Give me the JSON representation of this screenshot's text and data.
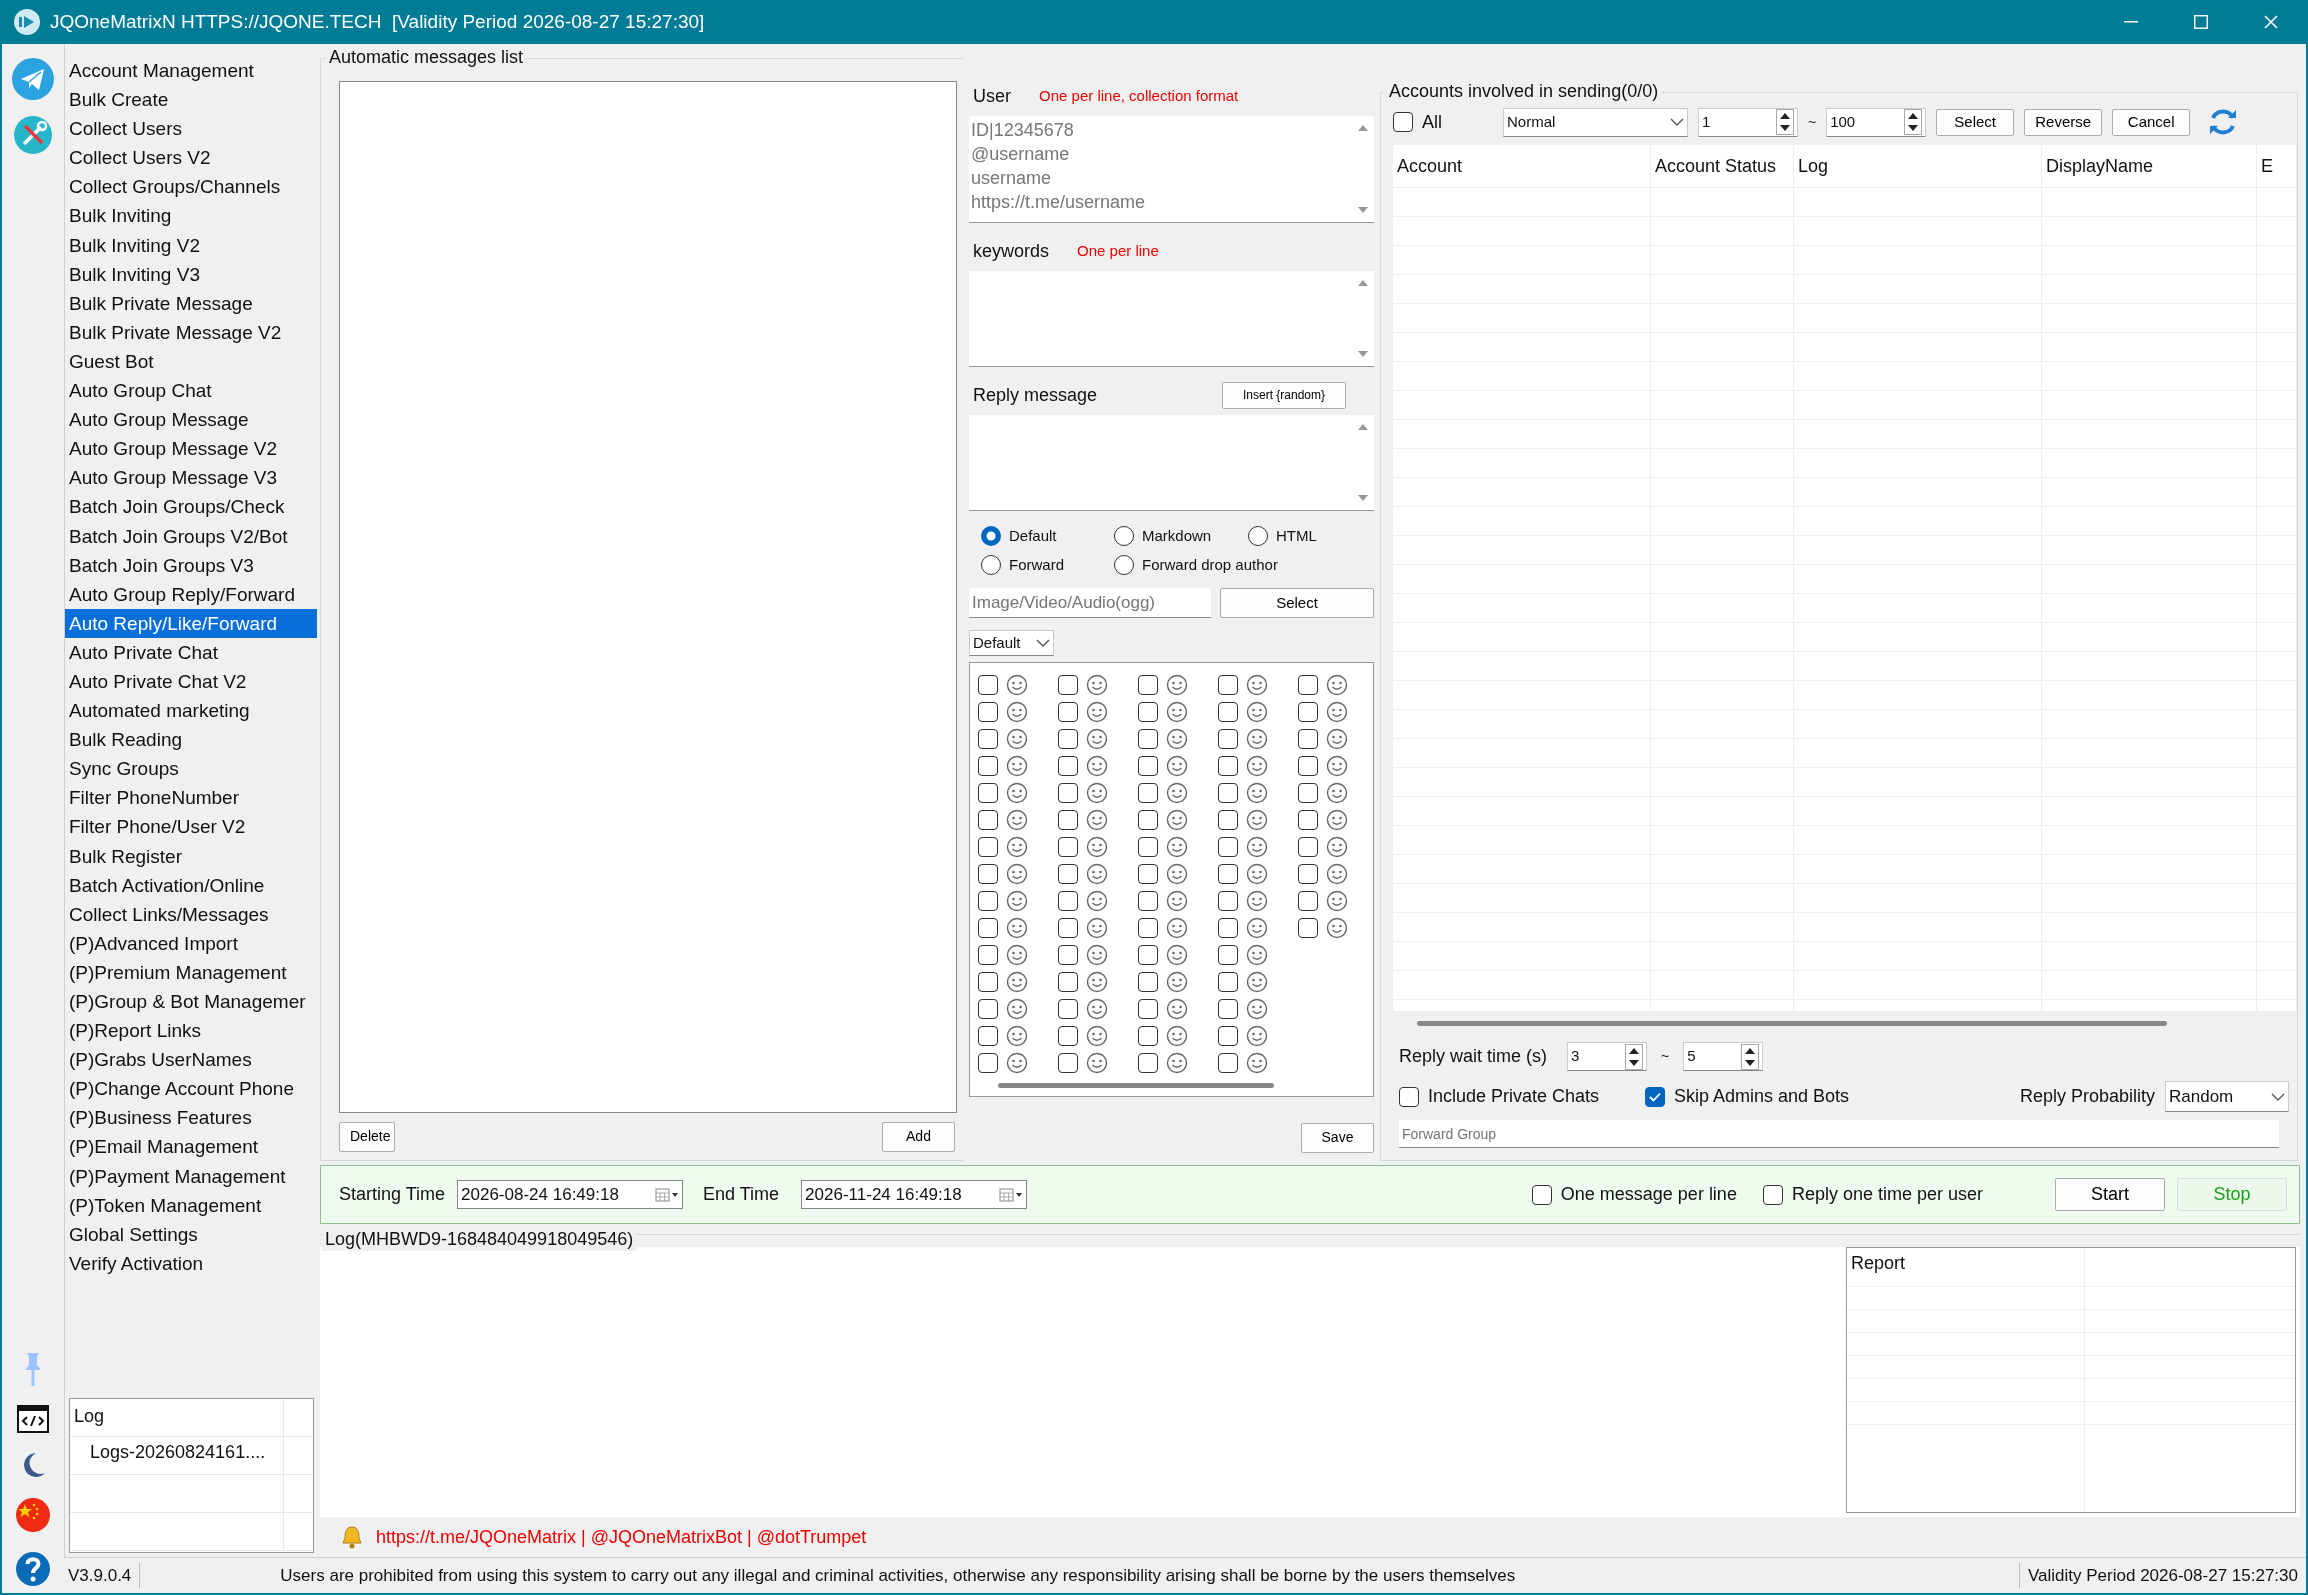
{
  "window": {
    "title": "JQOneMatrixN HTTPS://JQONE.TECH  [Validity Period 2026-08-27 15:27:30]"
  },
  "sidebar": {
    "items": [
      {
        "label": "Account Management",
        "selected": false
      },
      {
        "label": "Bulk Create",
        "selected": false
      },
      {
        "label": "Collect Users",
        "selected": false
      },
      {
        "label": "Collect Users V2",
        "selected": false
      },
      {
        "label": "Collect Groups/Channels",
        "selected": false
      },
      {
        "label": "Bulk Inviting",
        "selected": false
      },
      {
        "label": "Bulk Inviting V2",
        "selected": false
      },
      {
        "label": "Bulk Inviting V3",
        "selected": false
      },
      {
        "label": "Bulk Private Message",
        "selected": false
      },
      {
        "label": "Bulk Private Message V2",
        "selected": false
      },
      {
        "label": "Guest Bot",
        "selected": false
      },
      {
        "label": "Auto Group Chat",
        "selected": false
      },
      {
        "label": "Auto Group Message",
        "selected": false
      },
      {
        "label": "Auto Group Message V2",
        "selected": false
      },
      {
        "label": "Auto Group Message V3",
        "selected": false
      },
      {
        "label": "Batch Join Groups/Check",
        "selected": false
      },
      {
        "label": "Batch Join Groups V2/Bot",
        "selected": false
      },
      {
        "label": "Batch Join Groups V3",
        "selected": false
      },
      {
        "label": "Auto Group Reply/Forward",
        "selected": false
      },
      {
        "label": "Auto Reply/Like/Forward",
        "selected": true
      },
      {
        "label": "Auto Private Chat",
        "selected": false
      },
      {
        "label": "Auto Private Chat V2",
        "selected": false
      },
      {
        "label": "Automated marketing",
        "selected": false
      },
      {
        "label": "Bulk Reading",
        "selected": false
      },
      {
        "label": "Sync Groups",
        "selected": false
      },
      {
        "label": "Filter PhoneNumber",
        "selected": false
      },
      {
        "label": "Filter Phone/User V2",
        "selected": false
      },
      {
        "label": "Bulk Register",
        "selected": false
      },
      {
        "label": "Batch Activation/Online",
        "selected": false
      },
      {
        "label": "Collect Links/Messages",
        "selected": false
      },
      {
        "label": "(P)Advanced Import",
        "selected": false
      },
      {
        "label": "(P)Premium Management",
        "selected": false
      },
      {
        "label": "(P)Group & Bot Managemer",
        "selected": false
      },
      {
        "label": "(P)Report Links",
        "selected": false
      },
      {
        "label": "(P)Grabs UserNames",
        "selected": false
      },
      {
        "label": "(P)Change Account Phone",
        "selected": false
      },
      {
        "label": "(P)Business Features",
        "selected": false
      },
      {
        "label": "(P)Email Management",
        "selected": false
      },
      {
        "label": "(P)Payment Management",
        "selected": false
      },
      {
        "label": "(P)Token Management",
        "selected": false
      },
      {
        "label": "Global Settings",
        "selected": false
      },
      {
        "label": "Verify Activation",
        "selected": false
      }
    ]
  },
  "log_tree": {
    "items": [
      {
        "label": "Log",
        "children": [
          {
            "label": "Logs-20260824161...."
          }
        ]
      }
    ]
  },
  "version": "V3.9.0.4",
  "messages_list": {
    "title": "Automatic messages list",
    "buttons": [
      "Delete",
      "Add"
    ]
  },
  "user": {
    "label": "User",
    "hint": "One per line, collection format",
    "placeholder": "ID|12345678\n@username\nusername\nhttps://t.me/username"
  },
  "keywords": {
    "label": "keywords",
    "hint": "One per line"
  },
  "reply_message": {
    "label": "Reply message",
    "insert_button": "Insert {random}"
  },
  "format_options": [
    {
      "label": "Default",
      "selected": true
    },
    {
      "label": "Markdown",
      "selected": false
    },
    {
      "label": "HTML",
      "selected": false
    },
    {
      "label": "Forward",
      "selected": false
    },
    {
      "label": "Forward drop author",
      "selected": false
    }
  ],
  "media": {
    "placeholder": "Image/Video/Audio(ogg)",
    "button": "Select"
  },
  "emoji_style": {
    "value": "Default"
  },
  "emoji_options": [
    {
      "checked": false
    },
    {
      "checked": false
    },
    {
      "checked": false
    },
    {
      "checked": false
    },
    {
      "checked": false
    },
    {
      "checked": false
    },
    {
      "checked": false
    },
    {
      "checked": false
    },
    {
      "checked": false
    },
    {
      "checked": false
    },
    {
      "checked": false
    },
    {
      "checked": false
    },
    {
      "checked": false
    },
    {
      "checked": false
    },
    {
      "checked": false
    },
    {
      "checked": false
    },
    {
      "checked": false
    },
    {
      "checked": false
    },
    {
      "checked": false
    },
    {
      "checked": false
    },
    {
      "checked": false
    },
    {
      "checked": false
    },
    {
      "checked": false
    },
    {
      "checked": false
    },
    {
      "checked": false
    },
    {
      "checked": false
    },
    {
      "checked": false
    },
    {
      "checked": false
    },
    {
      "checked": false
    },
    {
      "checked": false
    },
    {
      "checked": false
    },
    {
      "checked": false
    },
    {
      "checked": false
    },
    {
      "checked": false
    },
    {
      "checked": false
    },
    {
      "checked": false
    },
    {
      "checked": false
    },
    {
      "checked": false
    },
    {
      "checked": false
    },
    {
      "checked": false
    },
    {
      "checked": false
    },
    {
      "checked": false
    },
    {
      "checked": false
    },
    {
      "checked": false
    },
    {
      "checked": false
    },
    {
      "checked": false
    },
    {
      "checked": false
    },
    {
      "checked": false
    },
    {
      "checked": false
    },
    {
      "checked": false
    },
    {
      "checked": false
    },
    {
      "checked": false
    },
    {
      "checked": false
    },
    {
      "checked": false
    },
    {
      "checked": false
    },
    {
      "checked": false
    },
    {
      "checked": false
    },
    {
      "checked": false
    },
    {
      "checked": false
    },
    {
      "checked": false
    },
    {
      "checked": false
    },
    {
      "checked": false
    },
    {
      "checked": false
    },
    {
      "checked": false
    },
    {
      "checked": false
    },
    {
      "checked": false
    },
    {
      "checked": false
    },
    {
      "checked": false
    },
    {
      "checked": false
    },
    {
      "checked": false
    }
  ],
  "save_button": "Save",
  "accounts": {
    "title": "Accounts involved in sending(0/0)",
    "all": {
      "label": "All",
      "checked": false
    },
    "mode": "Normal",
    "from": "1",
    "separator": "~",
    "to": "100",
    "buttons": [
      "Select",
      "Reverse",
      "Cancel"
    ],
    "columns": [
      "Account",
      "Account Status",
      "Log",
      "DisplayName",
      "E"
    ]
  },
  "reply_wait": {
    "label": "Reply wait time (s)",
    "min": "3",
    "separator": "~",
    "max": "5"
  },
  "options": [
    {
      "label": "Include Private Chats",
      "checked": false
    },
    {
      "label": "Skip Admins and Bots",
      "checked": true
    }
  ],
  "reply_probability": {
    "label": "Reply Probability",
    "value": "Random"
  },
  "forward_group": {
    "placeholder": "Forward Group"
  },
  "schedule": {
    "start_label": "Starting Time",
    "start": "2026-08-24 16:49:18",
    "end_label": "End Time",
    "end": "2026-11-24 16:49:18",
    "options": [
      {
        "label": "One message per line",
        "checked": false
      },
      {
        "label": "Reply one time per user",
        "checked": false
      }
    ],
    "buttons": [
      "Start",
      "Stop"
    ]
  },
  "log": {
    "title": "Log(MHBWD9-168484049918049546)",
    "report_column": "Report"
  },
  "links": "https://t.me/JQOneMatrix | @JQOneMatrixBot | @dotTrumpet",
  "status_bar": {
    "notice": "Users are prohibited from using this system to carry out any illegal and criminal activities, otherwise any responsibility arising shall be borne by the users themselves",
    "validity": "Validity Period 2026-08-27 15:27:30"
  }
}
